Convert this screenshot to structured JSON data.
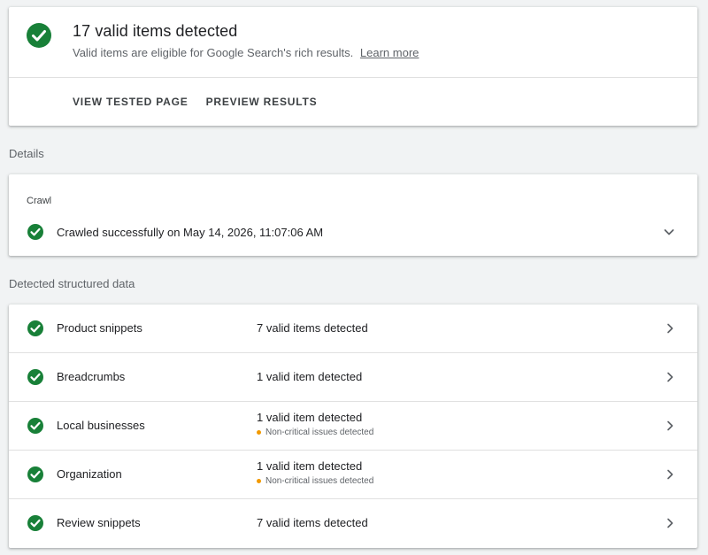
{
  "summary": {
    "title": "17 valid items detected",
    "subtitle": "Valid items are eligible for Google Search's rich results.",
    "learn_more": "Learn more",
    "icon": "check-circle-icon",
    "actions": {
      "view_tested_page": "VIEW TESTED PAGE",
      "preview_results": "PREVIEW RESULTS"
    }
  },
  "details": {
    "heading": "Details",
    "crawl": {
      "label": "Crawl",
      "status": "Crawled successfully on May 14, 2026, 11:07:06 AM",
      "icon": "check-circle-icon",
      "expand_icon": "chevron-down-icon"
    }
  },
  "structured_data": {
    "heading": "Detected structured data",
    "rows": [
      {
        "name": "Product snippets",
        "status": "7 valid items detected",
        "note": ""
      },
      {
        "name": "Breadcrumbs",
        "status": "1 valid item detected",
        "note": ""
      },
      {
        "name": "Local businesses",
        "status": "1 valid item detected",
        "note": "Non-critical issues detected"
      },
      {
        "name": "Organization",
        "status": "1 valid item detected",
        "note": "Non-critical issues detected"
      },
      {
        "name": "Review snippets",
        "status": "7 valid items detected",
        "note": ""
      }
    ]
  },
  "colors": {
    "success": "#188038",
    "warning": "#f29900",
    "background": "#f1f3f4",
    "text": "#202124",
    "muted": "#5f6368"
  }
}
